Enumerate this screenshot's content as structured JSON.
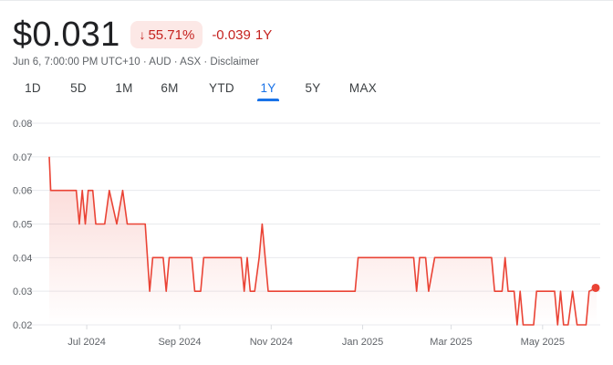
{
  "header": {
    "price": "$0.031",
    "change_pct": "55.71%",
    "change_arrow": "↓",
    "change_abs": "-0.039",
    "change_period": "1Y",
    "timestamp": "Jun 6, 7:00:00 PM UTC+10",
    "currency": "AUD",
    "exchange": "ASX",
    "disclaimer": "Disclaimer",
    "separator": " · ",
    "down_color": "#c5221f",
    "line_color": "#ea4335"
  },
  "ranges": [
    {
      "label": "1D",
      "active": false
    },
    {
      "label": "5D",
      "active": false
    },
    {
      "label": "1M",
      "active": false
    },
    {
      "label": "6M",
      "active": false
    },
    {
      "label": "YTD",
      "active": false
    },
    {
      "label": "1Y",
      "active": true
    },
    {
      "label": "5Y",
      "active": false
    },
    {
      "label": "MAX",
      "active": false
    }
  ],
  "chart_data": {
    "type": "line",
    "title": "",
    "xlabel": "",
    "ylabel": "",
    "ylim": [
      0.02,
      0.08
    ],
    "yticks": [
      0.08,
      0.07,
      0.06,
      0.05,
      0.04,
      0.03,
      0.02
    ],
    "xlim": [
      "2024-06-06",
      "2025-06-06"
    ],
    "xticks": [
      {
        "date": "2024-07-01",
        "label": "Jul 2024"
      },
      {
        "date": "2024-09-01",
        "label": "Sep 2024"
      },
      {
        "date": "2024-11-01",
        "label": "Nov 2024"
      },
      {
        "date": "2025-01-01",
        "label": "Jan 2025"
      },
      {
        "date": "2025-03-01",
        "label": "Mar 2025"
      },
      {
        "date": "2025-05-01",
        "label": "May 2025"
      }
    ],
    "grid": "horizontal",
    "series": [
      {
        "points": [
          [
            "2024-06-06",
            0.07
          ],
          [
            "2024-06-07",
            0.06
          ],
          [
            "2024-06-24",
            0.06
          ],
          [
            "2024-06-26",
            0.05
          ],
          [
            "2024-06-28",
            0.06
          ],
          [
            "2024-06-30",
            0.05
          ],
          [
            "2024-07-02",
            0.06
          ],
          [
            "2024-07-05",
            0.06
          ],
          [
            "2024-07-07",
            0.05
          ],
          [
            "2024-07-13",
            0.05
          ],
          [
            "2024-07-16",
            0.06
          ],
          [
            "2024-07-21",
            0.05
          ],
          [
            "2024-07-25",
            0.06
          ],
          [
            "2024-07-28",
            0.05
          ],
          [
            "2024-08-09",
            0.05
          ],
          [
            "2024-08-12",
            0.03
          ],
          [
            "2024-08-14",
            0.04
          ],
          [
            "2024-08-21",
            0.04
          ],
          [
            "2024-08-23",
            0.03
          ],
          [
            "2024-08-25",
            0.04
          ],
          [
            "2024-09-09",
            0.04
          ],
          [
            "2024-09-11",
            0.03
          ],
          [
            "2024-09-15",
            0.03
          ],
          [
            "2024-09-17",
            0.04
          ],
          [
            "2024-10-12",
            0.04
          ],
          [
            "2024-10-14",
            0.03
          ],
          [
            "2024-10-16",
            0.04
          ],
          [
            "2024-10-18",
            0.03
          ],
          [
            "2024-10-21",
            0.03
          ],
          [
            "2024-10-24",
            0.04
          ],
          [
            "2024-10-26",
            0.05
          ],
          [
            "2024-10-28",
            0.04
          ],
          [
            "2024-10-30",
            0.03
          ],
          [
            "2024-12-27",
            0.03
          ],
          [
            "2024-12-29",
            0.04
          ],
          [
            "2025-02-04",
            0.04
          ],
          [
            "2025-02-06",
            0.03
          ],
          [
            "2025-02-08",
            0.04
          ],
          [
            "2025-02-12",
            0.04
          ],
          [
            "2025-02-14",
            0.03
          ],
          [
            "2025-02-18",
            0.04
          ],
          [
            "2025-03-28",
            0.04
          ],
          [
            "2025-03-30",
            0.03
          ],
          [
            "2025-04-04",
            0.03
          ],
          [
            "2025-04-06",
            0.04
          ],
          [
            "2025-04-08",
            0.03
          ],
          [
            "2025-04-12",
            0.03
          ],
          [
            "2025-04-14",
            0.02
          ],
          [
            "2025-04-16",
            0.03
          ],
          [
            "2025-04-18",
            0.02
          ],
          [
            "2025-04-25",
            0.02
          ],
          [
            "2025-04-27",
            0.03
          ],
          [
            "2025-05-09",
            0.03
          ],
          [
            "2025-05-11",
            0.02
          ],
          [
            "2025-05-13",
            0.03
          ],
          [
            "2025-05-15",
            0.02
          ],
          [
            "2025-05-18",
            0.02
          ],
          [
            "2025-05-21",
            0.03
          ],
          [
            "2025-05-24",
            0.02
          ],
          [
            "2025-05-30",
            0.02
          ],
          [
            "2025-06-01",
            0.03
          ],
          [
            "2025-06-06",
            0.031
          ]
        ]
      }
    ]
  }
}
